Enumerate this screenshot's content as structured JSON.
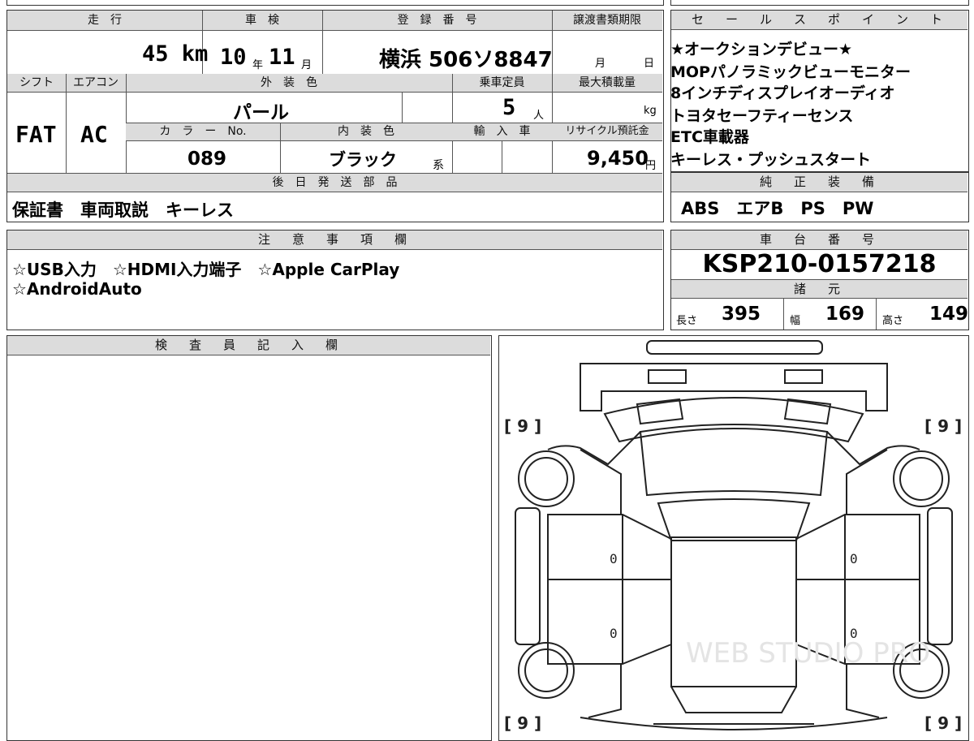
{
  "top_strip": {
    "partial_text": "■■"
  },
  "table": {
    "mileage_label": "走　行",
    "mileage_value": "45 km",
    "shaken_label": "車　検",
    "shaken_year": "10",
    "shaken_year_unit": "年",
    "shaken_month": "11",
    "shaken_month_unit": "月",
    "plate_label": "登　録　番　号",
    "plate_value": "横浜 506ソ8847",
    "transfer_label": "譲渡書類期限",
    "transfer_month": "月",
    "transfer_day": "日",
    "shift_label": "シフト",
    "shift_value": "FAT",
    "ac_label": "エアコン",
    "ac_value": "AC",
    "ext_color_label": "外　装　色",
    "ext_color_value": "パール",
    "capacity_label": "乗車定員",
    "capacity_value": "5",
    "capacity_unit": "人",
    "max_load_label": "最大積載量",
    "max_load_unit": "kg",
    "color_no_label": "カ　ラ　ー　No.",
    "color_no_value": "089",
    "int_color_label": "内　装　色",
    "int_color_value": "ブラック",
    "int_color_suffix": "系",
    "import_label": "輸　入　車",
    "recycle_label": "リサイクル預託金",
    "recycle_value": "9,450",
    "recycle_unit": "円",
    "later_parts_label": "後　日　発　送　部　品",
    "later_parts_value": "保証書　車両取説　キーレス"
  },
  "sales_points": {
    "label": "セ　ー　ル　ス　ポ　イ　ン　ト",
    "lines": [
      "★オークションデビュー★",
      "MOPパノラミックビューモニター",
      "8インチディスプレイオーディオ",
      "トヨタセーフティーセンス",
      "ETC車載器",
      "キーレス・プッシュスタート"
    ]
  },
  "equipment": {
    "label": "純　正　装　備",
    "value": "ABS　エアB　PS　PW"
  },
  "notes": {
    "label": "注　意　事　項　欄",
    "line1": "☆USB入力　☆HDMI入力端子　☆Apple CarPlay",
    "line2": "☆AndroidAuto"
  },
  "chassis": {
    "label": "車　台　番　号",
    "value": "KSP210-0157218"
  },
  "specs": {
    "label": "諸　元",
    "length_label": "長さ",
    "length_value": "395",
    "width_label": "幅",
    "width_value": "169",
    "height_label": "高さ",
    "height_value": "149"
  },
  "inspector": {
    "label": "検　査　員　記　入　欄"
  },
  "diagram": {
    "tire_fl": "[ 9 ]",
    "tire_fr": "[ 9 ]",
    "tire_rl": "[ 9 ]",
    "tire_rr": "[ 9 ]",
    "door_fl": "0",
    "door_rl": "0",
    "door_fr": "0",
    "door_rr": "0",
    "watermark": "WEB STUDIO PRO"
  }
}
